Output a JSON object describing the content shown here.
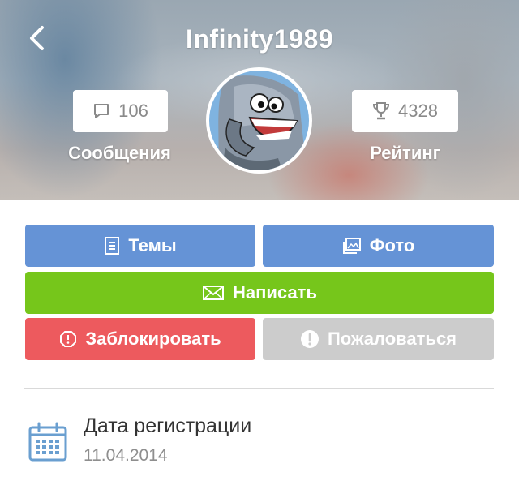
{
  "profile": {
    "username": "Infinity1989",
    "messages_count": "106",
    "messages_label": "Сообщения",
    "rating_value": "4328",
    "rating_label": "Рейтинг"
  },
  "actions": {
    "topics_label": "Темы",
    "photo_label": "Фото",
    "write_label": "Написать",
    "block_label": "Заблокировать",
    "report_label": "Пожаловаться"
  },
  "info": {
    "reg_label": "Дата регистрации",
    "reg_date": "11.04.2014"
  },
  "icons": {
    "back": "back-arrow-icon",
    "messages": "speech-bubble-icon",
    "rating": "trophy-icon",
    "topics": "document-icon",
    "photo": "image-icon",
    "write": "envelope-icon",
    "block": "stop-octagon-icon",
    "report": "exclamation-icon",
    "calendar": "calendar-icon"
  },
  "colors": {
    "primary_blue": "#6593d6",
    "write_green": "#76c61b",
    "block_red": "#ed5a5e",
    "report_gray": "#cccccc",
    "calendar_blue": "#6a9fd0"
  }
}
